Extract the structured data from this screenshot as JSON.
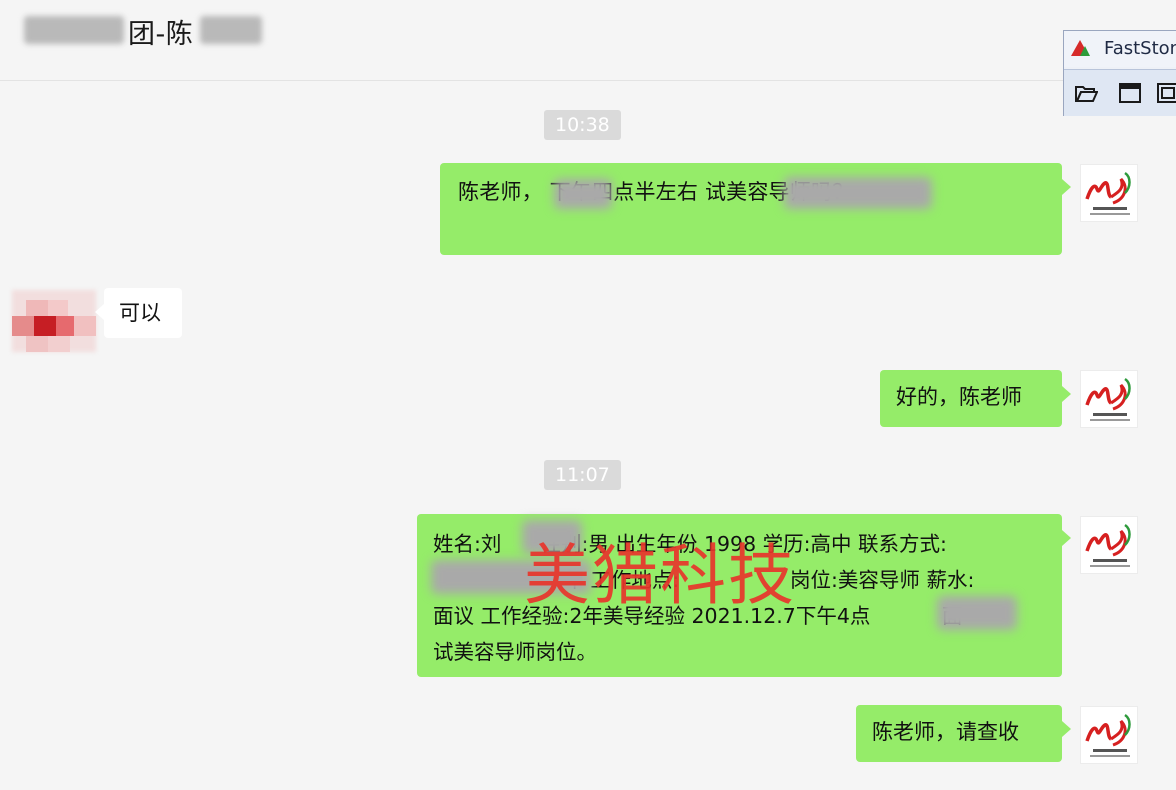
{
  "header": {
    "title_prefix": "",
    "title_visible": "团-陈",
    "title_suffix": ""
  },
  "toolbar": {
    "app_name": "FastSton",
    "buttons": [
      "open-icon",
      "window-icon",
      "region-icon"
    ]
  },
  "messages": [
    {
      "type": "time",
      "text": "10:38"
    },
    {
      "type": "sent",
      "text": "陈老师，          下午四点半左右                      试美容导师吗？"
    },
    {
      "type": "received",
      "text": "可以"
    },
    {
      "type": "sent",
      "text": "好的，陈老师"
    },
    {
      "type": "time",
      "text": "11:07"
    },
    {
      "type": "sent",
      "lines": [
        "姓名:刘      性别:男 出生年份 1998 学历:高中 联系方式:",
        "                    年 工作地点:                 岗位:美容导师 薪水:",
        "面议 工作经验:2年美导经验 2021.12.7下午4点           面",
        "试美容导师岗位。"
      ]
    },
    {
      "type": "sent",
      "text": "陈老师，请查收"
    }
  ],
  "watermark": "美猎科技",
  "colors": {
    "sent_bubble": "#95ec69",
    "received_bubble": "#ffffff",
    "background": "#f5f5f5",
    "watermark": "#e8352c",
    "timestamp_bg": "#dadada"
  }
}
